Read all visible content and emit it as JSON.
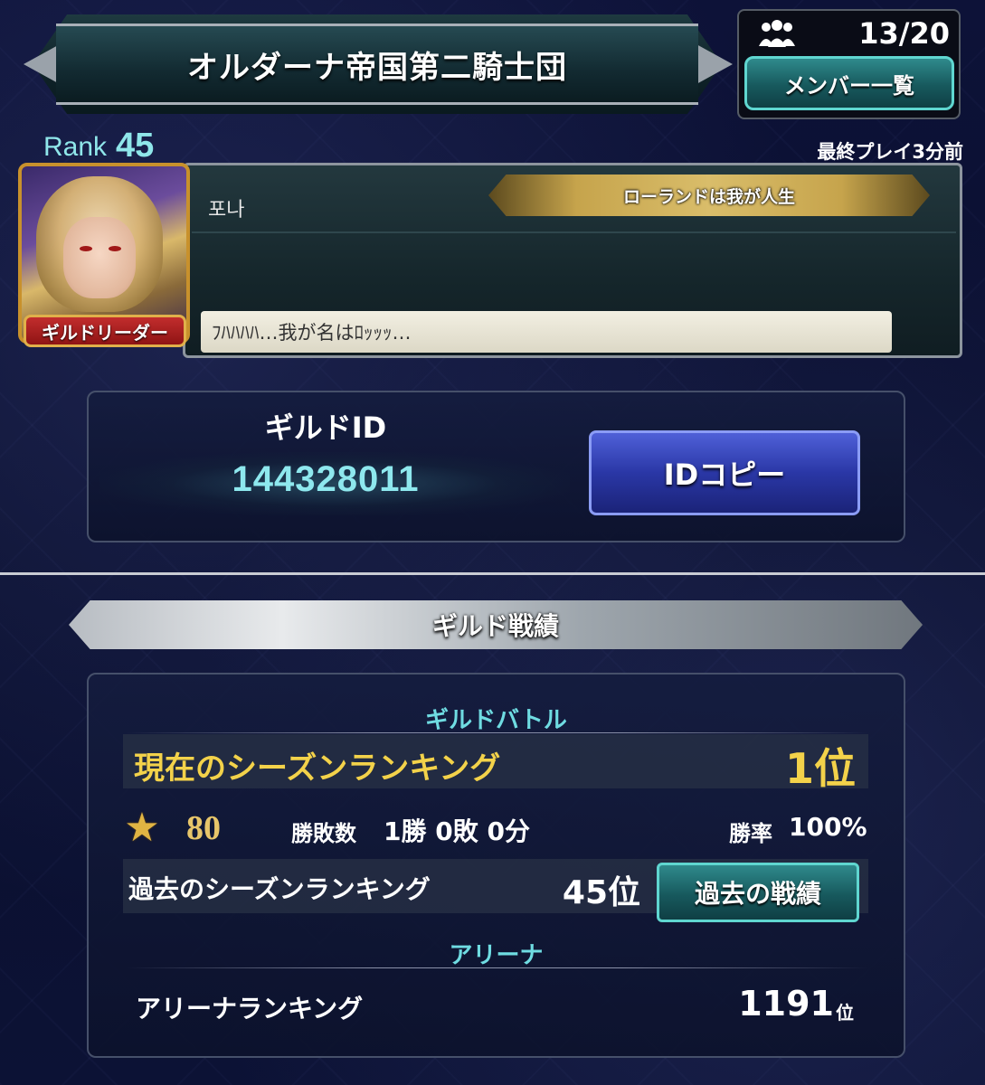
{
  "header": {
    "guild_name": "オルダーナ帝国第二騎士団",
    "member_count": "13/20",
    "member_list_button": "メンバー一覧",
    "member_icon": "group-icon"
  },
  "leader": {
    "rank_label": "Rank",
    "rank_value": "45",
    "last_play": "最終プレイ3分前",
    "badge": "ギルドリーダー",
    "name": "포나",
    "title": "ローランドは我が人生",
    "comment": "ﾌﾊﾊﾊﾊ…我が名はﾛｯｯｯ…"
  },
  "guild_id": {
    "label": "ギルドID",
    "value": "144328011",
    "copy_button": "IDコピー"
  },
  "record": {
    "section_title": "ギルド戦績",
    "battle_heading": "ギルドバトル",
    "current_label": "現在のシーズンランキング",
    "current_value": "1位",
    "star_icon": "star-icon",
    "points": "80",
    "win_loss_label": "勝敗数",
    "win_loss_value": "1勝 0敗 0分",
    "win_rate_label": "勝率",
    "win_rate_value": "100%",
    "past_label": "過去のシーズンランキング",
    "past_value": "45位",
    "past_button": "過去の戦績",
    "arena_heading": "アリーナ",
    "arena_label": "アリーナランキング",
    "arena_value": "1191",
    "arena_unit": "位"
  }
}
